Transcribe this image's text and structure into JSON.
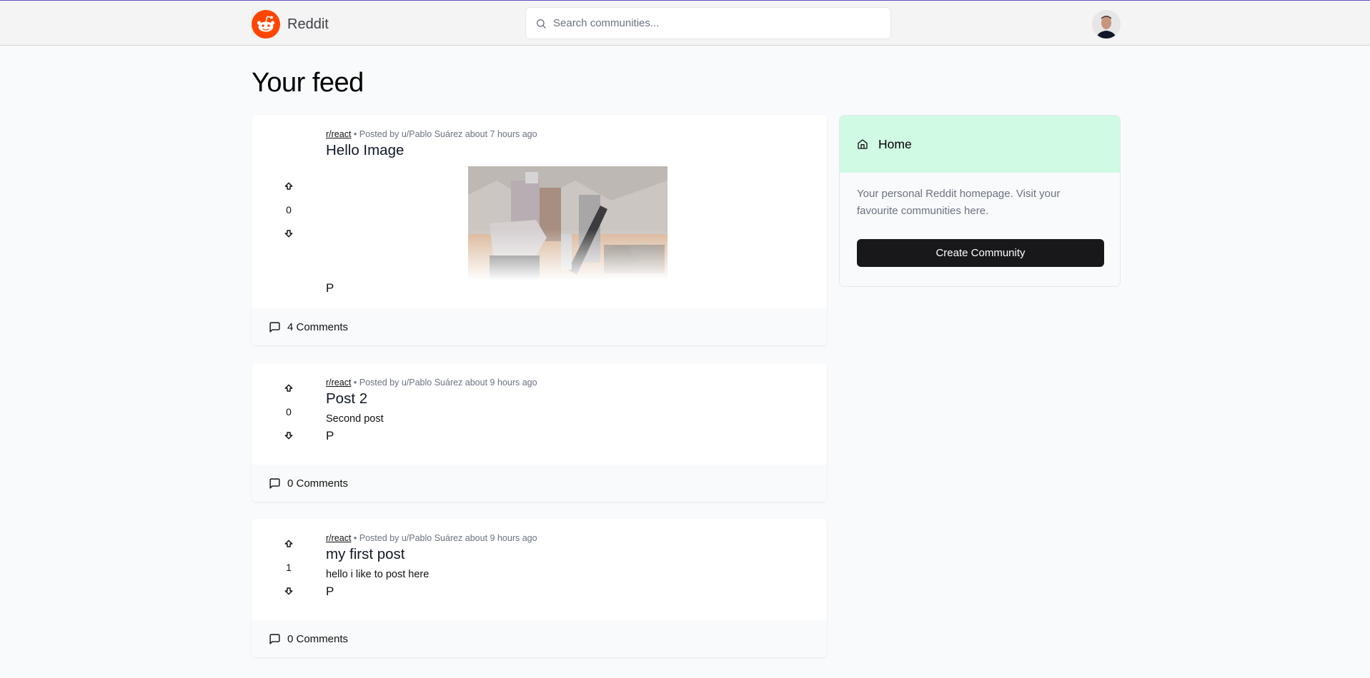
{
  "header": {
    "brand_name": "Reddit",
    "search_placeholder": "Search communities...",
    "search_value": "",
    "accent_color": "#ff4500"
  },
  "page": {
    "title": "Your feed"
  },
  "posts": [
    {
      "subreddit": "r/react",
      "meta": "• Posted by u/Pablo Suárez about 7 hours ago",
      "title": "Hello Image",
      "body": "",
      "has_image": true,
      "author_initial": "P",
      "votes": "0",
      "comments": "4 Comments"
    },
    {
      "subreddit": "r/react",
      "meta": "• Posted by u/Pablo Suárez about 9 hours ago",
      "title": "Post 2",
      "body": "Second post",
      "has_image": false,
      "author_initial": "P",
      "votes": "0",
      "comments": "0 Comments"
    },
    {
      "subreddit": "r/react",
      "meta": "• Posted by u/Pablo Suárez about 9 hours ago",
      "title": "my first post",
      "body": "hello i like to post here",
      "has_image": false,
      "author_initial": "P",
      "votes": "1",
      "comments": "0 Comments"
    }
  ],
  "sidebar": {
    "title": "Home",
    "description": "Your personal Reddit homepage. Visit your favourite communities here.",
    "create_button": "Create Community",
    "header_color": "#d1fae5"
  },
  "icons": {
    "logo": "reddit-logo-icon",
    "search": "search-icon",
    "upvote": "arrow-big-up-icon",
    "downvote": "arrow-big-down-icon",
    "comments": "message-square-icon",
    "home": "home-icon"
  }
}
